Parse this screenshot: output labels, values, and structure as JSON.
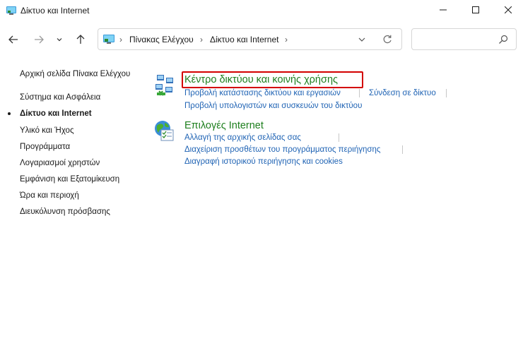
{
  "window": {
    "title": "Δίκτυο και Internet"
  },
  "toolbar": {
    "search_placeholder": ""
  },
  "breadcrumb": {
    "items": [
      "Πίνακας Ελέγχου",
      "Δίκτυο και Internet"
    ]
  },
  "sidebar": {
    "items": [
      {
        "label": "Αρχική σελίδα Πίνακα Ελέγχου",
        "active": false
      },
      {
        "label": "Σύστημα και Ασφάλεια",
        "active": false
      },
      {
        "label": "Δίκτυο και Internet",
        "active": true
      },
      {
        "label": "Υλικό και Ήχος",
        "active": false
      },
      {
        "label": "Προγράμματα",
        "active": false
      },
      {
        "label": "Λογαριασμοί χρηστών",
        "active": false
      },
      {
        "label": "Εμφάνιση και Εξατομίκευση",
        "active": false
      },
      {
        "label": "Ώρα και περιοχή",
        "active": false
      },
      {
        "label": "Διευκόλυνση πρόσβασης",
        "active": false
      }
    ]
  },
  "categories": [
    {
      "title": "Κέντρο δικτύου και κοινής χρήσης",
      "icon": "network-sharing-center-icon",
      "links": [
        "Προβολή κατάστασης δικτύου και εργασιών",
        "Σύνδεση σε δίκτυο",
        "Προβολή υπολογιστών και συσκευών του δικτύου"
      ]
    },
    {
      "title": "Επιλογές Internet",
      "icon": "internet-options-icon",
      "links": [
        "Αλλαγή της αρχικής σελίδας σας",
        "Διαχείριση προσθέτων του προγράμματος περιήγησης",
        "Διαγραφή ιστορικού περιήγησης και cookies"
      ]
    }
  ],
  "colors": {
    "category_title": "#1e7f1e",
    "link": "#1f63b4",
    "highlight": "#d30000"
  }
}
